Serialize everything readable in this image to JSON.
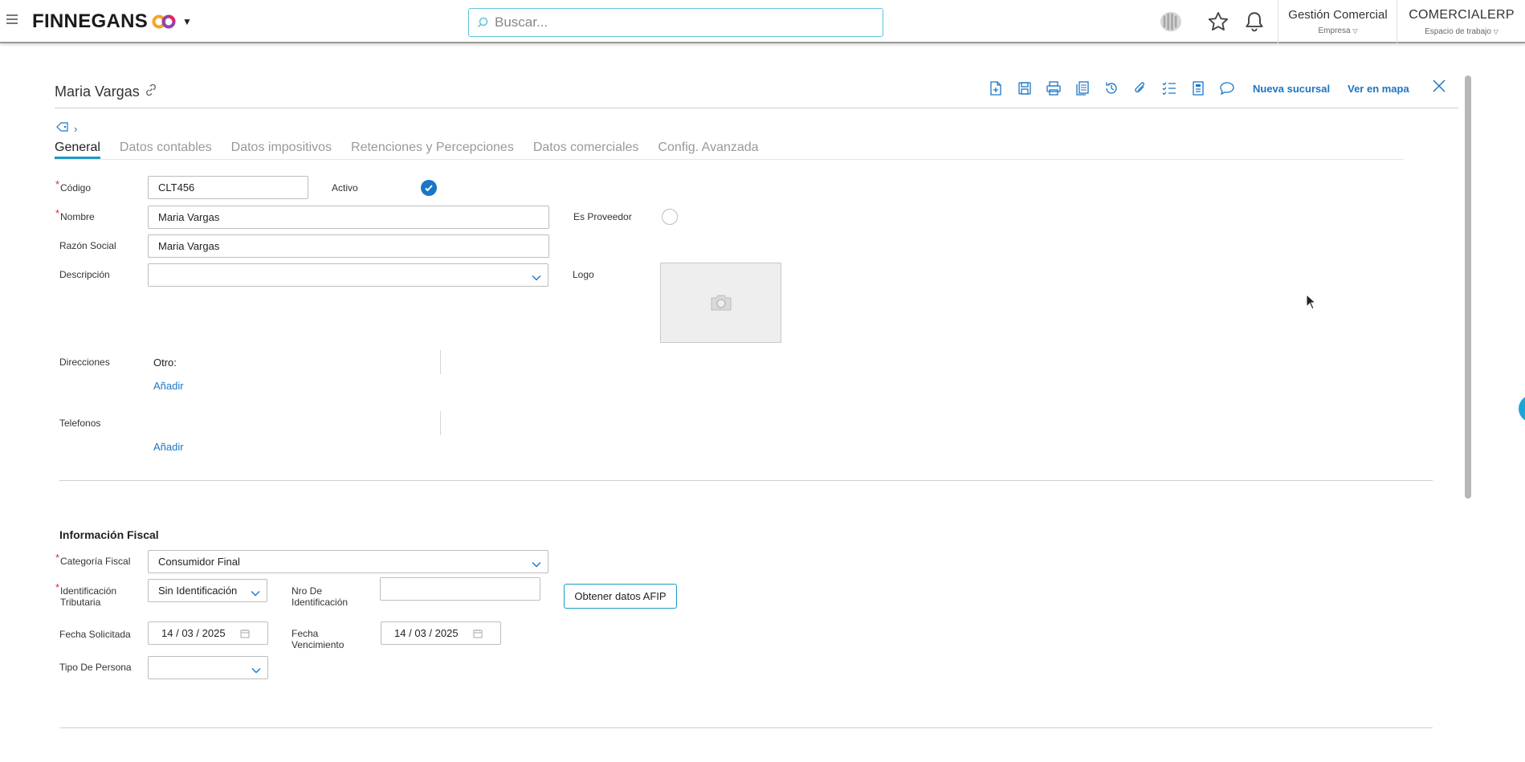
{
  "topbar": {
    "brand": "FINNEGANS",
    "search_placeholder": "Buscar...",
    "module": {
      "name": "Gestión Comercial",
      "sub": "Empresa"
    },
    "workspace": {
      "name": "COMERCIALERP",
      "sub": "Espacio de trabajo"
    }
  },
  "record": {
    "title": "Maria Vargas",
    "toolbar_links": {
      "nueva_sucursal": "Nueva sucursal",
      "ver_en_mapa": "Ver en mapa"
    }
  },
  "tabs": [
    "General",
    "Datos contables",
    "Datos impositivos",
    "Retenciones y Percepciones",
    "Datos comerciales",
    "Config. Avanzada"
  ],
  "general": {
    "codigo": {
      "label": "Código",
      "value": "CLT456"
    },
    "activo": {
      "label": "Activo",
      "checked": true
    },
    "nombre": {
      "label": "Nombre",
      "value": "Maria Vargas"
    },
    "es_proveedor": {
      "label": "Es Proveedor",
      "checked": false
    },
    "razon_social": {
      "label": "Razón Social",
      "value": "Maria Vargas"
    },
    "descripcion": {
      "label": "Descripción",
      "value": ""
    },
    "logo": {
      "label": "Logo"
    },
    "direcciones": {
      "label": "Direcciones",
      "item": "Otro:",
      "add": "Añadir"
    },
    "telefonos": {
      "label": "Telefonos",
      "add": "Añadir"
    }
  },
  "fiscal": {
    "title": "Información Fiscal",
    "categoria": {
      "label": "Categoría Fiscal",
      "value": "Consumidor Final"
    },
    "identificacion": {
      "label_1": "Identificación",
      "label_2": "Tributaria",
      "value": "Sin Identificación"
    },
    "nro": {
      "label_1": "Nro De",
      "label_2": "Identificación",
      "value": ""
    },
    "afip_button": "Obtener datos AFIP",
    "fecha_solicitada": {
      "label": "Fecha Solicitada",
      "day": "14",
      "month": "03",
      "year": "2025"
    },
    "fecha_vencimiento": {
      "label_1": "Fecha",
      "label_2": "Vencimiento",
      "day": "14",
      "month": "03",
      "year": "2025"
    },
    "tipo_persona": {
      "label": "Tipo De Persona",
      "value": ""
    }
  },
  "colors": {
    "accent": "#1a76c6",
    "teal": "#1a9bc6",
    "required": "#d32f2f"
  },
  "icons": [
    "menu-icon",
    "search-icon",
    "apps-icon",
    "star-icon",
    "bell-icon",
    "link-icon",
    "new-doc-icon",
    "save-icon",
    "print-icon",
    "copy-icon",
    "history-icon",
    "attach-icon",
    "checklist-icon",
    "report-icon",
    "comment-icon",
    "close-icon",
    "tag-icon",
    "camera-icon",
    "calendar-icon"
  ]
}
